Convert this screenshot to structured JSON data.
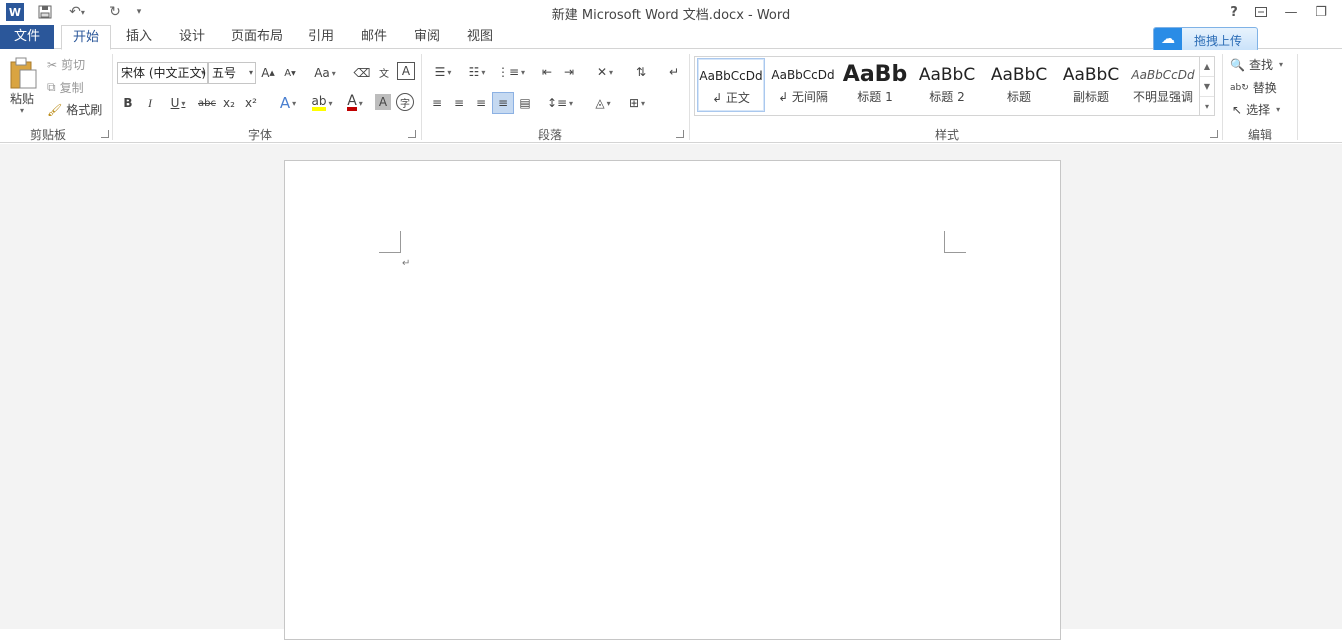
{
  "window": {
    "title": "新建 Microsoft Word 文档.docx - Word",
    "help": "?",
    "minimize": "—",
    "restore": "❐"
  },
  "tabs": [
    {
      "label": "文件"
    },
    {
      "label": "开始"
    },
    {
      "label": "插入"
    },
    {
      "label": "设计"
    },
    {
      "label": "页面布局"
    },
    {
      "label": "引用"
    },
    {
      "label": "邮件"
    },
    {
      "label": "审阅"
    },
    {
      "label": "视图"
    }
  ],
  "upload_button": "拖拽上传",
  "clipboard": {
    "paste": "粘贴",
    "cut": "剪切",
    "copy": "复制",
    "format_painter": "格式刷",
    "group": "剪贴板"
  },
  "font": {
    "name": "宋体 (中文正文)",
    "size": "五号",
    "bold": "B",
    "italic": "I",
    "underline": "U",
    "strike": "abc",
    "subscript": "x₂",
    "superscript": "x²",
    "case": "Aa",
    "font_color_letter": "A",
    "group": "字体"
  },
  "paragraph": {
    "group": "段落"
  },
  "styles": {
    "group": "样式",
    "items": [
      {
        "sample": "AaBbCcDd",
        "name": "↲ 正文"
      },
      {
        "sample": "AaBbCcDd",
        "name": "↲ 无间隔"
      },
      {
        "sample": "AaBb",
        "name": "标题 1"
      },
      {
        "sample": "AaBbC",
        "name": "标题 2"
      },
      {
        "sample": "AaBbC",
        "name": "标题"
      },
      {
        "sample": "AaBbC",
        "name": "副标题"
      },
      {
        "sample": "AaBbCcDd",
        "name": "不明显强调"
      }
    ]
  },
  "editing": {
    "find": "查找",
    "replace": "替换",
    "select": "选择",
    "group": "编辑"
  },
  "document": {
    "paragraph_mark": "↵"
  },
  "colors": {
    "accent": "#2b579a",
    "highlight": "#ffff00",
    "font_color": "#c00000"
  }
}
